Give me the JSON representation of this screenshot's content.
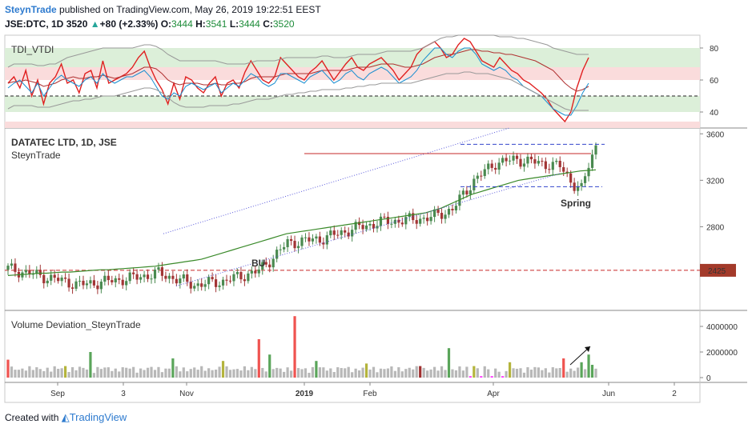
{
  "header": {
    "author": "SteynTrade",
    "published": "published on TradingView.com, May 26, 2019 19:22:51 EEST",
    "symbol": "JSE:DTC, 1D",
    "price": "3520",
    "change": "+80 (+2.33%)",
    "o_label": "O:",
    "o_value": "3444",
    "h_label": "H:",
    "h_value": "3541",
    "l_label": "L:",
    "l_value": "3444",
    "c_label": "C:",
    "c_value": "3520"
  },
  "footer": {
    "created_with": "Created with",
    "brand": "TradingView"
  },
  "colors": {
    "bull": "#4a8a50",
    "bear": "#a23535",
    "ma": "#3a8a2a",
    "tdi_red": "#e02020",
    "tdi_mid": "#b03030",
    "band_gray": "#999999",
    "blue_line": "#1a8fd0",
    "zone_green": "#dcefd9",
    "zone_pink": "#fadcdc",
    "volume_gray": "#b8b8b8",
    "volume_green": "#5aa55a",
    "volume_red": "#ef5350",
    "volume_olive": "#b4b43c",
    "volume_magenta": "#ff44ff",
    "volume_darkred": "#a03030"
  },
  "chart_data": [
    {
      "type": "line",
      "panel": "indicator",
      "title": "TDI_VTDI",
      "ylim": [
        30,
        88
      ],
      "yticks": [
        40,
        60,
        80
      ],
      "zones": [
        {
          "from": 68,
          "to": 80,
          "color": "zone_green"
        },
        {
          "from": 60,
          "to": 68,
          "color": "zone_pink"
        },
        {
          "from": 40,
          "to": 50,
          "color": "zone_green"
        },
        {
          "from": 30,
          "to": 34,
          "color": "zone_pink"
        }
      ],
      "midline": 50,
      "series": [
        {
          "key": "rsi",
          "color": "tdi_red",
          "values": [
            58,
            62,
            55,
            66,
            50,
            60,
            45,
            58,
            62,
            70,
            58,
            60,
            52,
            64,
            66,
            55,
            72,
            58,
            60,
            62,
            64,
            68,
            74,
            78,
            68,
            60,
            54,
            45,
            58,
            48,
            62,
            60,
            55,
            52,
            58,
            62,
            50,
            58,
            60,
            55,
            65,
            72,
            66,
            60,
            58,
            62,
            74,
            70,
            66,
            62,
            60,
            65,
            68,
            72,
            66,
            60,
            65,
            70,
            74,
            68,
            66,
            70,
            72,
            74,
            70,
            66,
            60,
            64,
            68,
            76,
            80,
            82,
            84,
            80,
            74,
            76,
            82,
            86,
            84,
            78,
            72,
            70,
            68,
            74,
            70,
            66,
            64,
            60,
            58,
            55,
            52,
            48,
            42,
            38,
            34,
            40,
            55,
            66,
            74
          ]
        },
        {
          "key": "signal",
          "color": "tdi_mid",
          "values": [
            58,
            59,
            59,
            60,
            59,
            58,
            56,
            57,
            58,
            60,
            61,
            62,
            61,
            61,
            62,
            62,
            63,
            62,
            61,
            62,
            63,
            64,
            66,
            68,
            68,
            67,
            64,
            60,
            58,
            57,
            58,
            58,
            58,
            57,
            57,
            58,
            57,
            57,
            58,
            58,
            59,
            61,
            62,
            62,
            62,
            62,
            63,
            64,
            64,
            64,
            64,
            64,
            65,
            66,
            66,
            66,
            66,
            66,
            67,
            68,
            68,
            68,
            69,
            70,
            70,
            70,
            69,
            68,
            68,
            69,
            70,
            72,
            74,
            75,
            76,
            76,
            77,
            78,
            79,
            79,
            78,
            78,
            77,
            77,
            76,
            76,
            75,
            74,
            73,
            72,
            70,
            68,
            66,
            62,
            58,
            55,
            53,
            54,
            56
          ]
        },
        {
          "key": "blue",
          "color": "blue_line",
          "values": [
            55,
            58,
            60,
            56,
            52,
            58,
            50,
            55,
            60,
            63,
            60,
            58,
            56,
            60,
            62,
            58,
            64,
            60,
            58,
            60,
            62,
            62,
            64,
            66,
            62,
            56,
            50,
            48,
            52,
            50,
            56,
            58,
            56,
            54,
            56,
            58,
            52,
            55,
            58,
            56,
            60,
            64,
            62,
            58,
            56,
            58,
            64,
            64,
            62,
            60,
            58,
            62,
            64,
            66,
            62,
            58,
            60,
            64,
            66,
            62,
            60,
            64,
            66,
            68,
            66,
            62,
            58,
            60,
            62,
            66,
            72,
            76,
            80,
            80,
            76,
            74,
            78,
            80,
            80,
            76,
            70,
            68,
            66,
            68,
            66,
            62,
            60,
            56,
            54,
            52,
            50,
            46,
            42,
            40,
            38,
            38,
            44,
            52,
            58
          ]
        },
        {
          "key": "upper",
          "color": "band_gray",
          "values": [
            68,
            70,
            70,
            70,
            70,
            69,
            69,
            70,
            70,
            72,
            74,
            75,
            76,
            77,
            78,
            79,
            80,
            80,
            80,
            80,
            80,
            80,
            81,
            82,
            82,
            81,
            79,
            76,
            74,
            72,
            72,
            72,
            72,
            72,
            72,
            72,
            71,
            70,
            70,
            70,
            70,
            71,
            72,
            72,
            72,
            72,
            73,
            74,
            74,
            74,
            74,
            74,
            74,
            75,
            75,
            74,
            74,
            74,
            75,
            76,
            76,
            76,
            76,
            77,
            78,
            78,
            78,
            78,
            78,
            79,
            80,
            82,
            84,
            86,
            87,
            87,
            88,
            88,
            88,
            88,
            88,
            88,
            88,
            87,
            87,
            87,
            86,
            86,
            85,
            84,
            83,
            82,
            80,
            79,
            78,
            77,
            76,
            76,
            76
          ]
        },
        {
          "key": "lower",
          "color": "band_gray",
          "values": [
            42,
            44,
            44,
            44,
            44,
            43,
            43,
            43,
            44,
            45,
            46,
            47,
            47,
            48,
            48,
            49,
            50,
            50,
            50,
            51,
            52,
            53,
            54,
            55,
            55,
            54,
            52,
            49,
            46,
            44,
            43,
            43,
            43,
            43,
            44,
            44,
            44,
            44,
            45,
            45,
            46,
            47,
            48,
            48,
            48,
            49,
            50,
            51,
            51,
            52,
            52,
            53,
            53,
            54,
            54,
            54,
            54,
            55,
            55,
            56,
            56,
            57,
            57,
            58,
            58,
            58,
            58,
            58,
            58,
            59,
            60,
            61,
            62,
            63,
            64,
            64,
            64,
            65,
            65,
            64,
            64,
            64,
            63,
            62,
            61,
            60,
            58,
            56,
            54,
            52,
            50,
            48,
            46,
            44,
            42,
            41,
            41,
            41,
            41
          ]
        }
      ]
    },
    {
      "type": "candlestick",
      "panel": "price",
      "title": "DATATEC LTD, 1D, JSE",
      "subtitle": "SteynTrade",
      "ylim": [
        2080,
        3650
      ],
      "yticks": [
        2800,
        3200,
        3600
      ],
      "price_marker": "2425",
      "ma_values": [
        2380,
        2385,
        2390,
        2395,
        2400,
        2400,
        2405,
        2410,
        2410,
        2415,
        2420,
        2425,
        2430,
        2430,
        2435,
        2440,
        2445,
        2450,
        2455,
        2460,
        2470,
        2480,
        2490,
        2500,
        2510,
        2520,
        2540,
        2560,
        2580,
        2600,
        2620,
        2640,
        2660,
        2680,
        2700,
        2720,
        2740,
        2750,
        2760,
        2770,
        2780,
        2790,
        2800,
        2810,
        2820,
        2830,
        2840,
        2850,
        2860,
        2870,
        2880,
        2890,
        2900,
        2910,
        2920,
        2940,
        2960,
        2990,
        3020,
        3050,
        3080,
        3100,
        3120,
        3140,
        3160,
        3180,
        3200,
        3210,
        3220,
        3230,
        3240,
        3250,
        3260,
        3270,
        3280,
        3285,
        3290
      ],
      "trend_upper": [
        [
          2838,
          3470
        ],
        [
          2838,
          3650
        ]
      ],
      "candles": [
        [
          2440,
          2420
        ],
        [
          2410,
          2395
        ],
        [
          2400,
          2380
        ],
        [
          2385,
          2370
        ],
        [
          2370,
          2360
        ],
        [
          2360,
          2400
        ],
        [
          2400,
          2380
        ],
        [
          2380,
          2350
        ],
        [
          2360,
          2320
        ],
        [
          2320,
          2340
        ],
        [
          2340,
          2300
        ],
        [
          2300,
          2330
        ],
        [
          2330,
          2380
        ],
        [
          2380,
          2350
        ],
        [
          2350,
          2400
        ],
        [
          2400,
          2410
        ],
        [
          2410,
          2370
        ],
        [
          2370,
          2330
        ],
        [
          2330,
          2300
        ],
        [
          2300,
          2260
        ],
        [
          2260,
          2300
        ],
        [
          2300,
          2350
        ],
        [
          2350,
          2400
        ],
        [
          2400,
          2330
        ],
        [
          2330,
          2280
        ],
        [
          2280,
          2310
        ],
        [
          2310,
          2360
        ],
        [
          2360,
          2340
        ],
        [
          2340,
          2300
        ],
        [
          2300,
          2340
        ],
        [
          2340,
          2380
        ],
        [
          2380,
          2390
        ],
        [
          2390,
          2350
        ],
        [
          2350,
          2400
        ],
        [
          2400,
          2460
        ],
        [
          2460,
          2420
        ],
        [
          2420,
          2380
        ],
        [
          2380,
          2340
        ],
        [
          2340,
          2300
        ],
        [
          2300,
          2330
        ],
        [
          2330,
          2360
        ],
        [
          2360,
          2380
        ],
        [
          2380,
          2370
        ],
        [
          2370,
          2400
        ],
        [
          2400,
          2430
        ],
        [
          2430,
          2480
        ],
        [
          2480,
          2520
        ],
        [
          2520,
          2580
        ],
        [
          2580,
          2640
        ],
        [
          2640,
          2700
        ],
        [
          2700,
          2680
        ],
        [
          2680,
          2650
        ],
        [
          2650,
          2620
        ],
        [
          2620,
          2660
        ],
        [
          2660,
          2700
        ],
        [
          2700,
          2650
        ],
        [
          2650,
          2600
        ],
        [
          2600,
          2640
        ],
        [
          2640,
          2680
        ],
        [
          2680,
          2720
        ],
        [
          2720,
          2700
        ],
        [
          2700,
          2660
        ],
        [
          2660,
          2680
        ],
        [
          2680,
          2720
        ],
        [
          2720,
          2760
        ],
        [
          2760,
          2800
        ],
        [
          2800,
          2720
        ],
        [
          2720,
          2660
        ],
        [
          2660,
          2700
        ],
        [
          2700,
          2760
        ],
        [
          2760,
          2720
        ],
        [
          2720,
          2680
        ],
        [
          2680,
          2700
        ],
        [
          2700,
          2740
        ],
        [
          2740,
          2800
        ],
        [
          2800,
          2850
        ]
      ]
    },
    {
      "type": "bar",
      "panel": "volume",
      "title": "Volume Deviation_SteynTrade",
      "ylim": [
        0,
        5000000
      ],
      "yticks": [
        0,
        2000000,
        4000000
      ],
      "ytick_labels": [
        "0",
        "2000000",
        "4000000"
      ]
    }
  ],
  "xaxis": {
    "labels": [
      "Sep",
      "3",
      "Nov",
      "2019",
      "Feb",
      "Apr",
      "Jun",
      "2"
    ],
    "bold": [
      "2019"
    ]
  },
  "annotations": {
    "bu": "BU",
    "spring": "Spring"
  }
}
